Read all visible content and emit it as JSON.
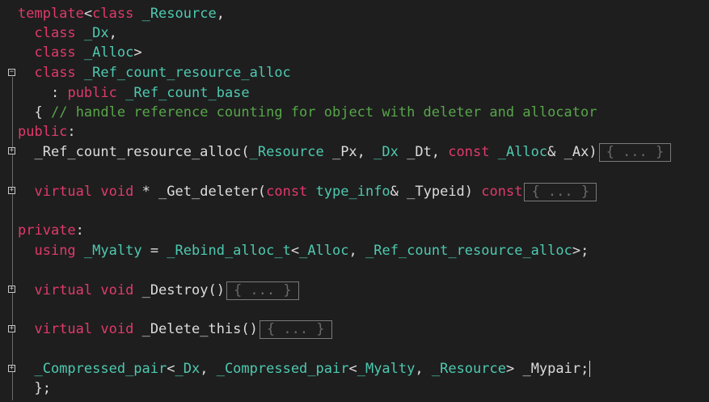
{
  "code": {
    "l1_template": "template",
    "l1_class": "class",
    "l1_resource": "_Resource",
    "l2_class": "class",
    "l2_dx": "_Dx",
    "l3_class": "class",
    "l3_alloc": "_Alloc",
    "l4_class": "class",
    "l4_name": "_Ref_count_resource_alloc",
    "l5_public": "public",
    "l5_base": "_Ref_count_base",
    "l6_comment": "// handle reference counting for object with deleter and allocator",
    "l7_public": "public",
    "l8_ctor": "_Ref_count_resource_alloc(",
    "l8_resource": "_Resource",
    "l8_px": " _Px, ",
    "l8_dx": "_Dx",
    "l8_dt": " _Dt, ",
    "l8_const": "const",
    "l8_alloc": "_Alloc",
    "l8_ax": "& _Ax)",
    "l8_collapsed": "{ ... }",
    "l9_virtual": "virtual",
    "l9_void": "void",
    "l9_get": " * _Get_deleter(",
    "l9_const": "const",
    "l9_typeinfo": "type_info",
    "l9_typeid": "& _Typeid) ",
    "l9_const2": "const",
    "l9_collapsed": "{ ... }",
    "l10_private": "private",
    "l11_using": "using",
    "l11_myalty": "_Myalty",
    "l11_eq": " = ",
    "l11_rebind": "_Rebind_alloc_t",
    "l11_alloc": "_Alloc",
    "l11_name": "_Ref_count_resource_alloc",
    "l12_virtual": "virtual",
    "l12_void": "void",
    "l12_destroy": " _Destroy()",
    "l12_collapsed": "{ ... }",
    "l13_virtual": "virtual",
    "l13_void": "void",
    "l13_delete": " _Delete_this()",
    "l13_collapsed": "{ ... }",
    "l14_cp": "_Compressed_pair",
    "l14_dx": "_Dx",
    "l14_cp2": "_Compressed_pair",
    "l14_myalty": "_Myalty",
    "l14_resource": "_Resource",
    "l14_mypair": "> _Mypair;",
    "l15_close": "};"
  },
  "colors": {
    "background": "#1e1e1e",
    "keyword": "#e03a6b",
    "type": "#4ec9b0",
    "comment": "#57a64a",
    "text": "#dcdcdc"
  },
  "icons": [
    "fold-collapse-icon",
    "fold-expand-icon"
  ]
}
